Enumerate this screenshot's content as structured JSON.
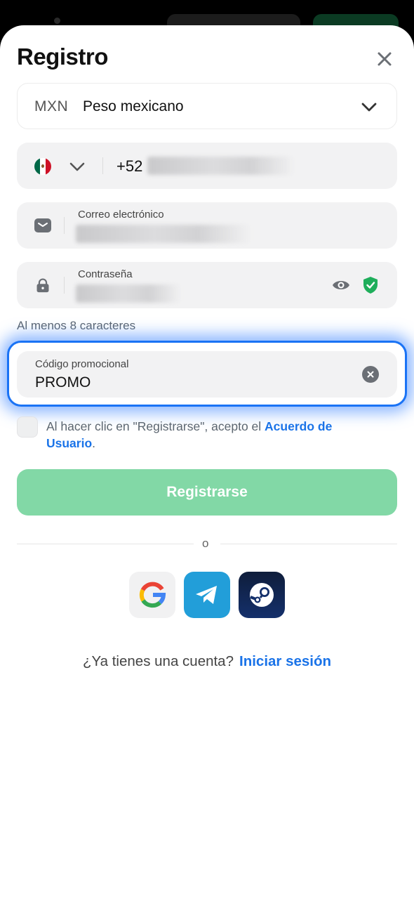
{
  "modal": {
    "title": "Registro"
  },
  "currency": {
    "code": "MXN",
    "name": "Peso mexicano"
  },
  "phone": {
    "prefix": "+52",
    "flag_colors": [
      "#006847",
      "#ffffff",
      "#ce1126"
    ]
  },
  "email": {
    "label": "Correo electrónico"
  },
  "password": {
    "label": "Contraseña",
    "hint": "Al menos 8 caracteres"
  },
  "promo": {
    "label": "Código promocional",
    "value": "PROMO"
  },
  "terms": {
    "text": "Al hacer clic en \"Registrarse\", acepto el ",
    "link": "Acuerdo de Usuario",
    "end": "."
  },
  "submit_label": "Registrarse",
  "divider_text": "o",
  "social": [
    "google-icon",
    "telegram-icon",
    "steam-icon"
  ],
  "login": {
    "question": "¿Ya tienes una cuenta?",
    "link": "Iniciar sesión"
  },
  "colors": {
    "accent_blue": "#1a73e8",
    "submit_green": "#82d8a6",
    "shield_green": "#1fae5b",
    "promo_outline": "#1a73f5"
  }
}
